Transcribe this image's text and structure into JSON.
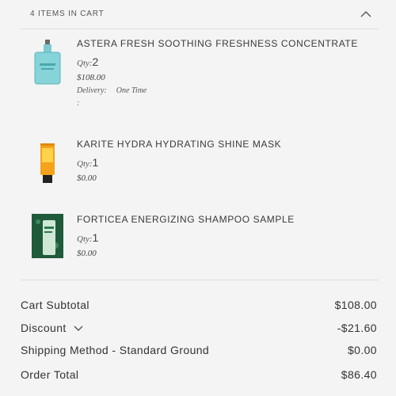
{
  "cart": {
    "header": "4 ITEMS IN CART",
    "items": [
      {
        "name": "ASTERA FRESH SOOTHING FRESHNESS CONCENTRATE",
        "qty_label": "Qty:",
        "qty": "2",
        "price": "$108.00",
        "delivery_label": "Delivery:",
        "delivery_value": "One Time",
        "extra": ":"
      },
      {
        "name": "KARITE HYDRA HYDRATING SHINE MASK",
        "qty_label": "Qty:",
        "qty": "1",
        "price": "$0.00"
      },
      {
        "name": "FORTICEA ENERGIZING SHAMPOO SAMPLE",
        "qty_label": "Qty:",
        "qty": "1",
        "price": "$0.00"
      }
    ]
  },
  "summary": {
    "subtotal_label": "Cart Subtotal",
    "subtotal_value": "$108.00",
    "discount_label": "Discount",
    "discount_value": "-$21.60",
    "shipping_label": "Shipping Method - Standard Ground",
    "shipping_value": "$0.00",
    "total_label": "Order Total",
    "total_value": "$86.40"
  },
  "icons": {
    "collapse": "chevron-up-icon",
    "discount_toggle": "chevron-down-icon"
  },
  "colors": {
    "background": "#f4f4f4",
    "text": "#333333",
    "divider": "#dcdcdc"
  }
}
